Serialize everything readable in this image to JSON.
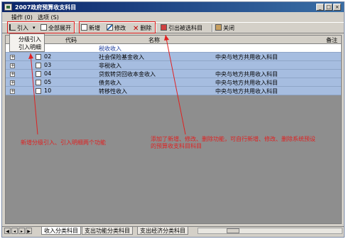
{
  "window": {
    "title": "2007政府预算收支科目"
  },
  "menubar": {
    "items": [
      "操作 (0)",
      "选项 (S)"
    ]
  },
  "toolbar": {
    "import": "引入",
    "expand_all": "全部展开",
    "new": "新增",
    "modify": "修改",
    "delete": "删除",
    "export_selected": "引出被选科目",
    "close": "关闭"
  },
  "popup": {
    "items": [
      "分级引入",
      "引入明细"
    ]
  },
  "grid": {
    "headers": {
      "code": "代码",
      "name": "名称",
      "note": "备注"
    },
    "rows": [
      {
        "code": "",
        "name": "税收收入",
        "note": "",
        "selected": true
      },
      {
        "code": "02",
        "name": "社会保险基金收入",
        "note": "中央与地方共用收入科目",
        "selected": false
      },
      {
        "code": "03",
        "name": "非税收入",
        "note": "",
        "selected": false
      },
      {
        "code": "04",
        "name": "贷款转贷回收本金收入",
        "note": "中央与地方共用收入科目",
        "selected": false
      },
      {
        "code": "05",
        "name": "债务收入",
        "note": "中央与地方共用收入科目",
        "selected": false
      },
      {
        "code": "10",
        "name": "转移性收入",
        "note": "中央与地方共用收入科目",
        "selected": false
      }
    ]
  },
  "annotations": {
    "left": "新增分级引入、引入明细两个功能",
    "right_line1": "添加了新增、修改、删除功能，可自行新增、修改、删除系统预设",
    "right_line2": "的预算收支科目科目"
  },
  "tabs": [
    "收入分类科目",
    "支出功能分类科目",
    "支出经济分类科目"
  ],
  "colors": {
    "selection": "#a6bde0",
    "annotation": "#e02020",
    "title_bar": "#0a246a"
  }
}
